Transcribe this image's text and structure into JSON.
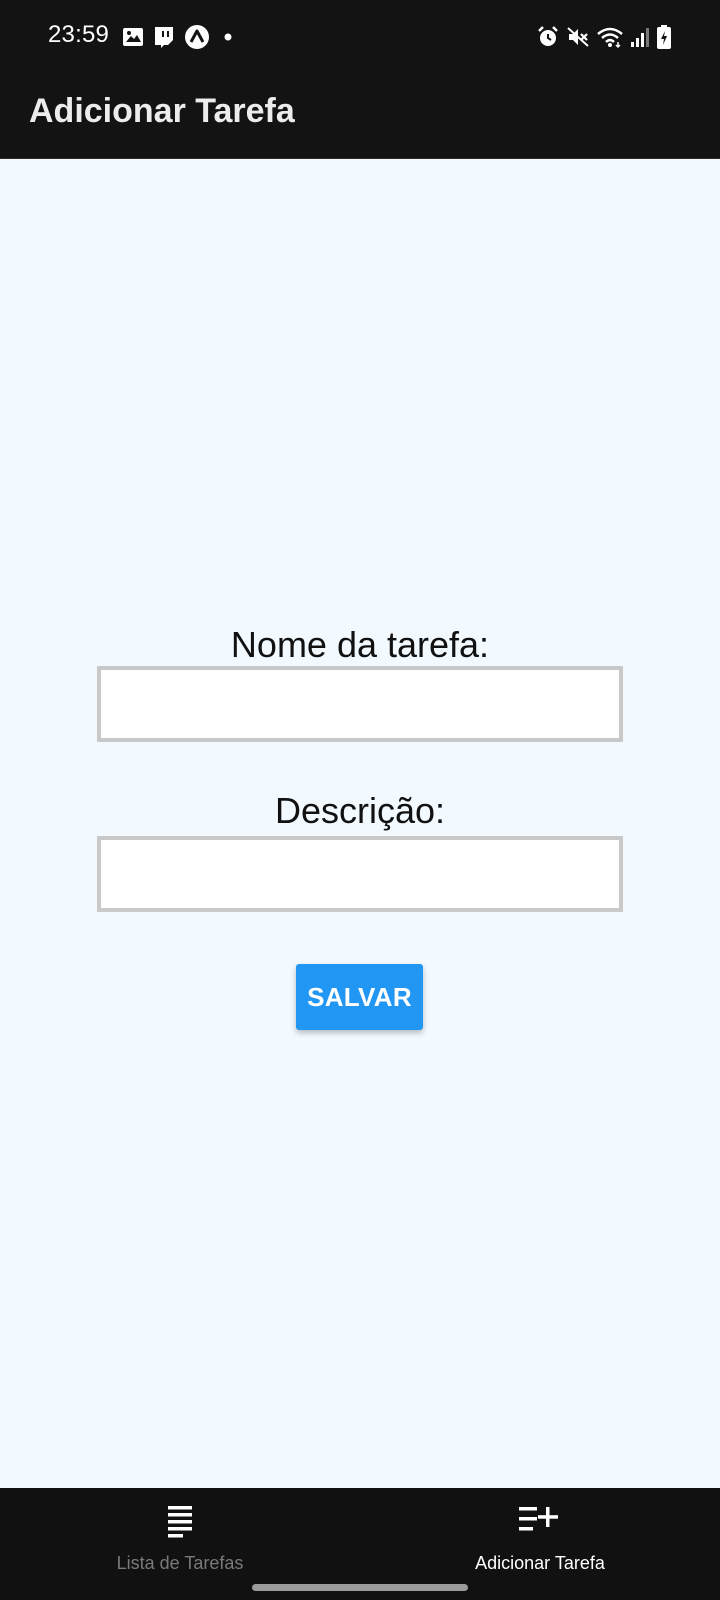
{
  "status_bar": {
    "time": "23:59",
    "left_icons": [
      "gallery-icon",
      "twitch-icon",
      "expo-icon",
      "notification-dot-icon"
    ],
    "right_icons": [
      "alarm-icon",
      "mute-icon",
      "wifi-icon",
      "signal-icon",
      "battery-charging-icon"
    ]
  },
  "app_bar": {
    "title": "Adicionar Tarefa"
  },
  "form": {
    "name_label": "Nome da tarefa:",
    "name_value": "",
    "description_label": "Descrição:",
    "description_value": "",
    "save_label": "SALVAR"
  },
  "bottom_nav": {
    "items": [
      {
        "label": "Lista de Tarefas",
        "icon": "list-icon",
        "active": false
      },
      {
        "label": "Adicionar Tarefa",
        "icon": "playlist-add-icon",
        "active": true
      }
    ]
  },
  "colors": {
    "background": "#f3faff",
    "bars": "#131313",
    "accent": "#2296f3",
    "input_border": "#c9c9c9",
    "nav_inactive": "#7a7a7a",
    "nav_active": "#ffffff"
  }
}
